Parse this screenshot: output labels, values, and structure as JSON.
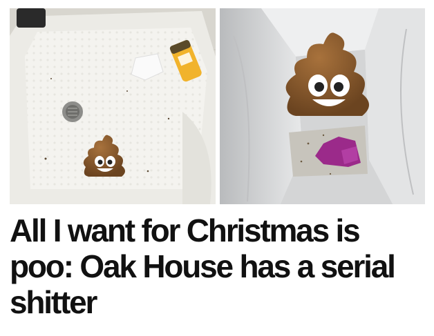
{
  "article": {
    "headline": "All I want for Christmas is poo: Oak House has a serial shitter"
  },
  "images": {
    "left": {
      "subject": "shower tray",
      "icon": "poop-emoji-icon"
    },
    "right": {
      "subject": "laundry bag",
      "icon": "poop-emoji-icon"
    }
  },
  "colors": {
    "poop_brown": "#8a5a2b",
    "poop_dark": "#6b4420",
    "tray_white": "#f2f1ec",
    "bag_grey": "#d9dadb",
    "purple_item": "#9b2a8a",
    "sponge_yellow": "#f1b32c"
  }
}
